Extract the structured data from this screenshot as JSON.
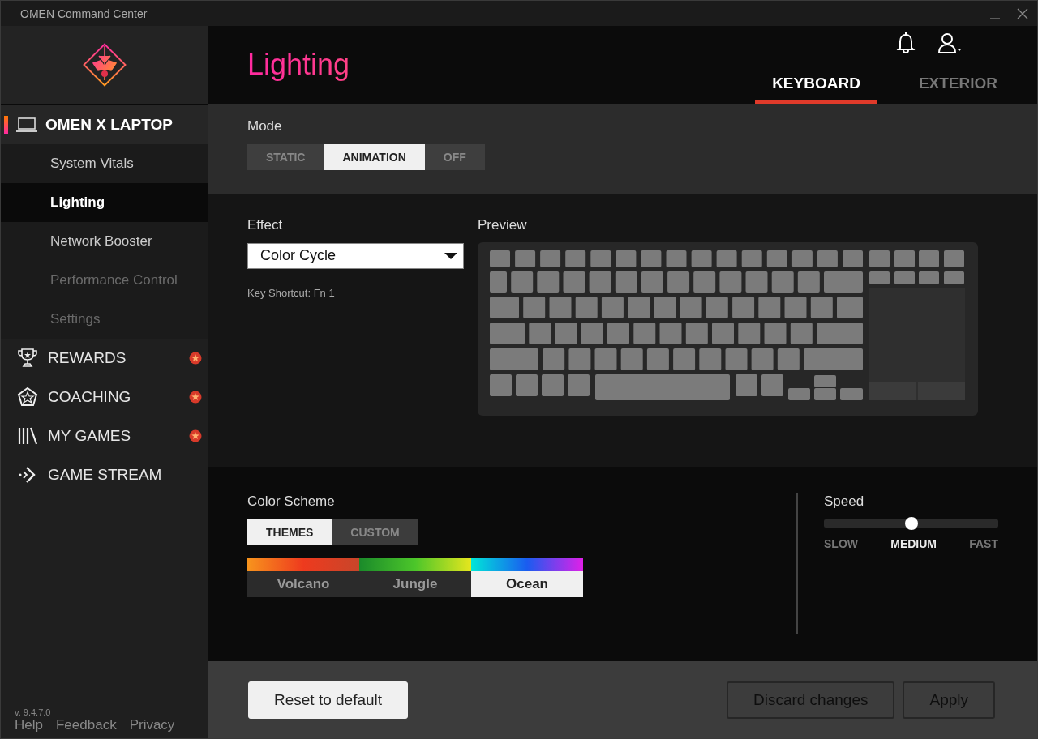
{
  "window": {
    "title": "OMEN Command Center"
  },
  "sidebar": {
    "device": {
      "label": "OMEN X LAPTOP",
      "selected": true
    },
    "sub_items": [
      {
        "label": "System Vitals",
        "selected": false,
        "disabled": false
      },
      {
        "label": "Lighting",
        "selected": true,
        "disabled": false
      },
      {
        "label": "Network Booster",
        "selected": false,
        "disabled": false
      },
      {
        "label": "Performance Control",
        "selected": false,
        "disabled": true
      },
      {
        "label": "Settings",
        "selected": false,
        "disabled": true
      }
    ],
    "sections": [
      {
        "kind": "trophy",
        "label": "REWARDS",
        "notification": true
      },
      {
        "kind": "pentagon",
        "label": "COACHING",
        "notification": true
      },
      {
        "kind": "library",
        "label": "MY GAMES",
        "notification": true
      },
      {
        "kind": "stream",
        "label": "GAME STREAM",
        "notification": false
      }
    ],
    "version": "v. 9.4.7.0",
    "links": [
      "Help",
      "Feedback",
      "Privacy"
    ]
  },
  "header": {
    "title": "Lighting",
    "tabs": [
      {
        "label": "KEYBOARD",
        "selected": true
      },
      {
        "label": "EXTERIOR",
        "selected": false
      }
    ]
  },
  "mode": {
    "label": "Mode",
    "options": [
      {
        "label": "STATIC",
        "selected": false
      },
      {
        "label": "ANIMATION",
        "selected": true
      },
      {
        "label": "OFF",
        "selected": false
      }
    ]
  },
  "effect": {
    "label": "Effect",
    "value": "Color Cycle",
    "shortcut": "Key Shortcut: Fn 1"
  },
  "preview": {
    "label": "Preview"
  },
  "color_scheme": {
    "label": "Color Scheme",
    "tabs": [
      {
        "label": "THEMES",
        "selected": true
      },
      {
        "label": "CUSTOM",
        "selected": false
      }
    ],
    "themes": [
      {
        "name": "Volcano",
        "selected": false,
        "kind": "volcano"
      },
      {
        "name": "Jungle",
        "selected": false,
        "kind": "jungle"
      },
      {
        "name": "Ocean",
        "selected": true,
        "kind": "ocean"
      }
    ]
  },
  "speed": {
    "label": "Speed",
    "level": 0.5,
    "options": [
      {
        "label": "SLOW",
        "selected": false
      },
      {
        "label": "MEDIUM",
        "selected": true
      },
      {
        "label": "FAST",
        "selected": false
      }
    ]
  },
  "footer": {
    "buttons": [
      {
        "label": "Reset to default",
        "disabled": false
      },
      {
        "label": "Discard changes",
        "disabled": true
      },
      {
        "label": "Apply",
        "disabled": true
      }
    ]
  }
}
